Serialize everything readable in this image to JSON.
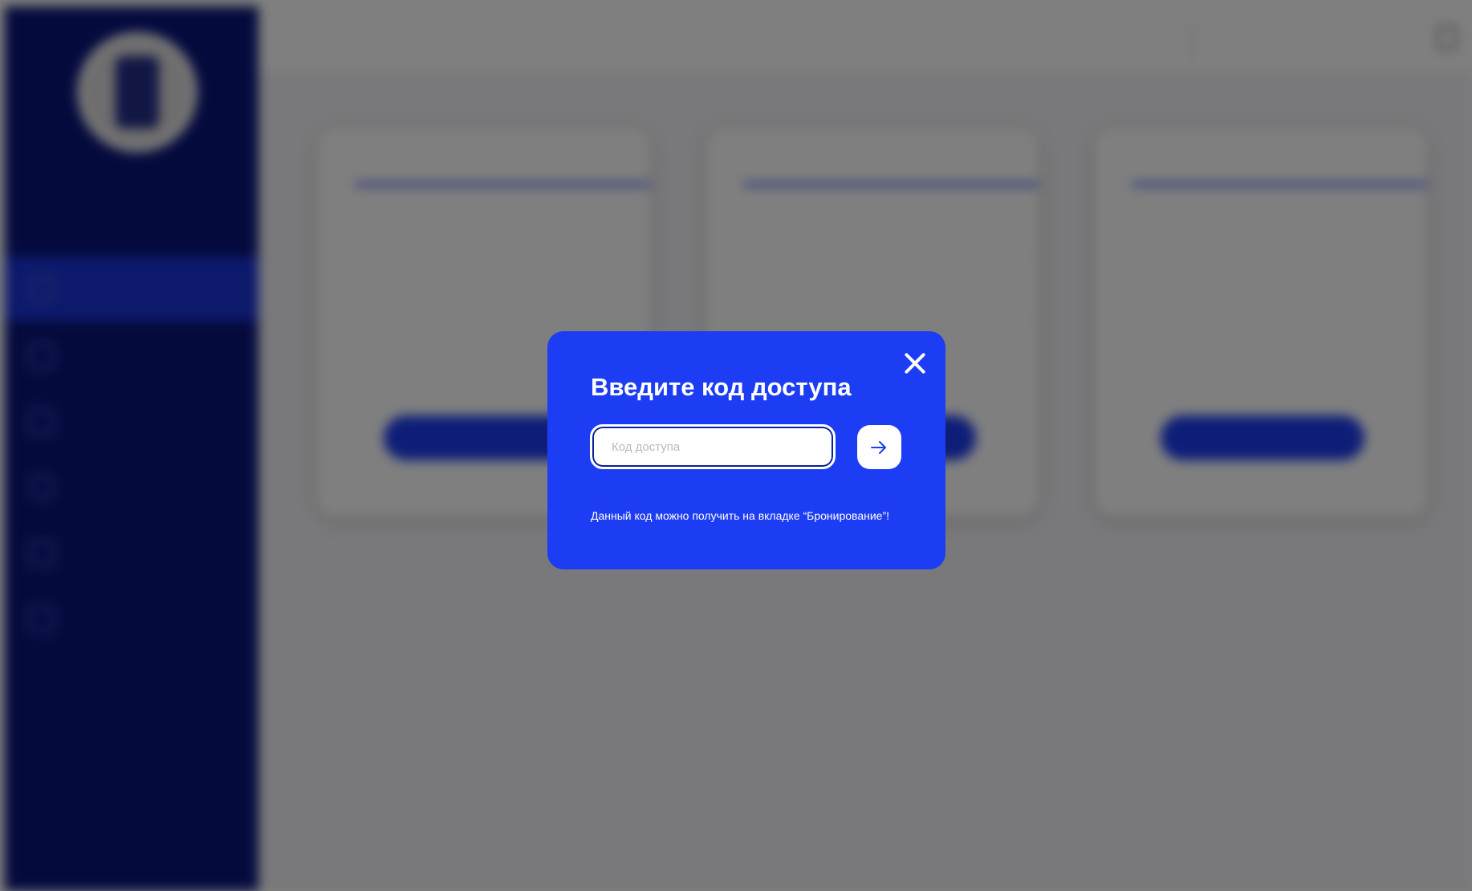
{
  "sidebar": {
    "logo_icon": "university-seal-logo",
    "org_name": "",
    "items": [
      {
        "label": "",
        "icon": "stand-icon",
        "active": true
      },
      {
        "label": "",
        "icon": "stand-icon",
        "active": false
      },
      {
        "label": "",
        "icon": "calendar-icon",
        "active": false
      },
      {
        "label": "",
        "icon": "info-icon",
        "active": false
      },
      {
        "label": "",
        "icon": "document-icon",
        "active": false
      },
      {
        "label": "",
        "icon": "gallery-icon",
        "active": false
      }
    ]
  },
  "header": {
    "title": "",
    "user_name": "",
    "logout_icon": "logout-icon"
  },
  "cards": [
    {
      "title": "",
      "fields": [
        {
          "label": "",
          "value": ""
        },
        {
          "label": "",
          "value": ""
        },
        {
          "label": "",
          "value": ""
        }
      ],
      "button_label": "",
      "link_label": ""
    },
    {
      "title": "",
      "fields": [
        {
          "label": "",
          "value": ""
        },
        {
          "label": "",
          "value": ""
        },
        {
          "label": "",
          "value": ""
        }
      ],
      "button_label": "",
      "link_label": ""
    },
    {
      "title": "",
      "fields": [
        {
          "label": "",
          "value": ""
        },
        {
          "label": "",
          "value": ""
        },
        {
          "label": "",
          "value": ""
        }
      ],
      "button_label": "",
      "link_label": ""
    }
  ],
  "modal": {
    "title": "Введите код доступа",
    "input_placeholder": "Код доступа",
    "input_value": "",
    "hint": "Данный код можно получить на вкладке “Бронирование”!",
    "submit_icon": "arrow-right-icon",
    "close_icon": "close-icon"
  },
  "colors": {
    "sidebar_bg": "#0a157a",
    "accent": "#1d3df0",
    "modal_bg": "#1d3df5",
    "overlay": "rgba(0,0,0,0.5)"
  }
}
